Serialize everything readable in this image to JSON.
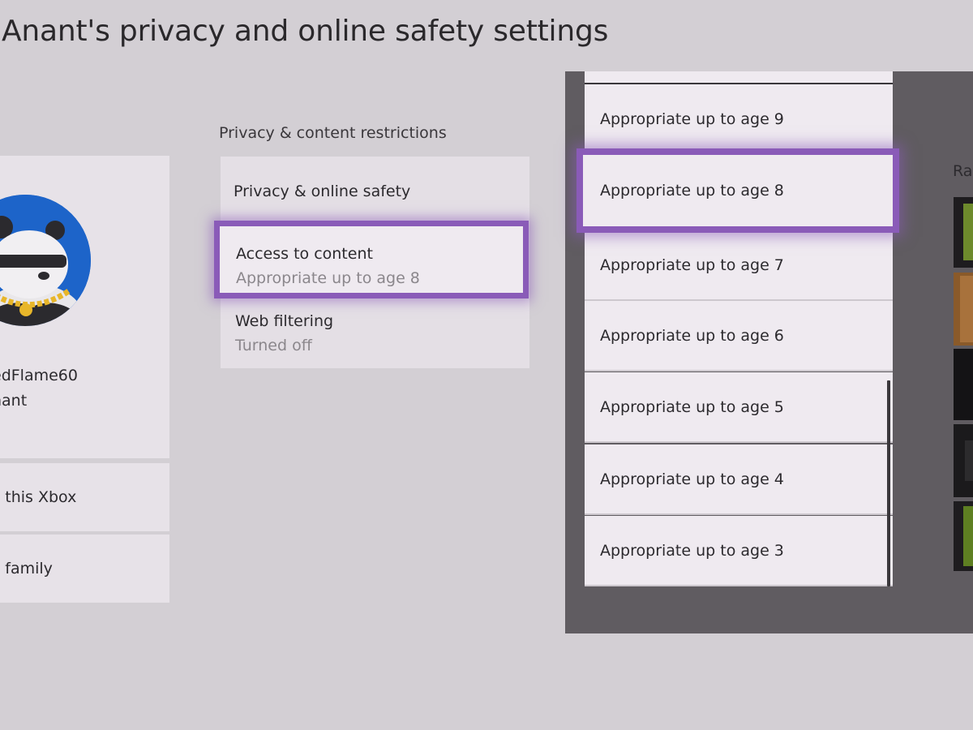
{
  "header": {
    "title": "Anant's privacy and online safety settings"
  },
  "profile": {
    "gamertag": "edFlame60",
    "name": "nant",
    "avatar_icon": "panda-avatar-icon",
    "avatar_bg_color": "#1d64c9",
    "actions": [
      {
        "label": "from this Xbox"
      },
      {
        "label": "from family"
      }
    ]
  },
  "restrictions": {
    "heading": "Privacy & content restrictions",
    "items": [
      {
        "label": "Privacy & online safety"
      },
      {
        "label": "Access to content",
        "value": "Appropriate up to age 8"
      },
      {
        "label": "Web filtering",
        "value": "Turned off"
      }
    ]
  },
  "age_options": {
    "selected": "Appropriate up to age 8",
    "items": [
      {
        "label": "Appropriate up to age 9"
      },
      {
        "label": "Appropriate up to age 8"
      },
      {
        "label": "Appropriate up to age 7"
      },
      {
        "label": "Appropriate up to age 6"
      },
      {
        "label": "Appropriate up to age 5"
      },
      {
        "label": "Appropriate up to age 4"
      },
      {
        "label": "Appropriate up to age 3"
      }
    ]
  },
  "right_panel": {
    "partial_label": "Ra"
  },
  "theme": {
    "focus_color": "#8a5bb8",
    "overlay_color": "#605c61",
    "background_color": "#d3cfd4"
  }
}
